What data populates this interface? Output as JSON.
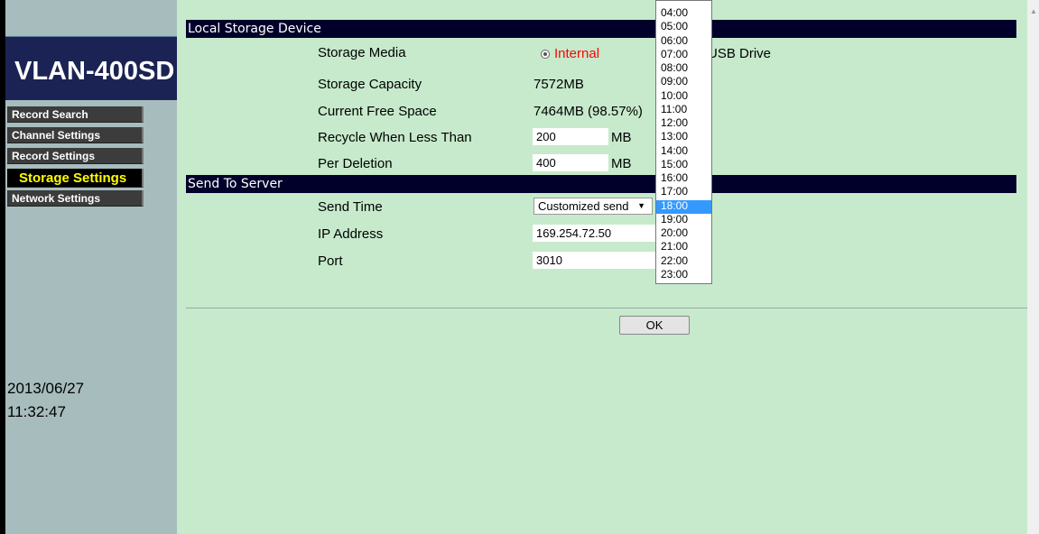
{
  "brand": "VLAN-400SD",
  "nav": [
    {
      "label": "Record Search"
    },
    {
      "label": "Channel Settings"
    },
    {
      "label": "Record Settings"
    },
    {
      "label": "Storage Settings"
    },
    {
      "label": "Network Settings"
    }
  ],
  "datetime": {
    "date": "2013/06/27",
    "time": "11:32:47"
  },
  "local": {
    "section_title": "Local Storage Device",
    "storage_media_label": "Storage Media",
    "internal_label": "Internal",
    "usb_label": "USB Drive",
    "capacity_label": "Storage Capacity",
    "capacity_value": "7572MB",
    "free_label": "Current Free Space",
    "free_value": "7464MB (98.57%)",
    "recycle_label": "Recycle When Less Than",
    "recycle_value": "200",
    "recycle_unit": "MB",
    "deletion_label": "Per Deletion",
    "deletion_value": "400",
    "deletion_unit": "MB"
  },
  "server": {
    "section_title": "Send To Server",
    "send_time_label": "Send Time",
    "send_time_value": "Customized send",
    "ip_label": "IP Address",
    "ip_value": "169.254.72.50",
    "port_label": "Port",
    "port_value": "3010"
  },
  "ok_label": "OK",
  "dropdown": {
    "options": [
      "04:00",
      "05:00",
      "06:00",
      "07:00",
      "08:00",
      "09:00",
      "10:00",
      "11:00",
      "12:00",
      "13:00",
      "14:00",
      "15:00",
      "16:00",
      "17:00",
      "18:00",
      "19:00",
      "20:00",
      "21:00",
      "22:00",
      "23:00"
    ],
    "selected": "18:00"
  },
  "colors": {
    "accent": "#ffff00",
    "internal_text": "#ff0000",
    "section_bar": "#00002a",
    "page_bg": "#c6eacb"
  }
}
